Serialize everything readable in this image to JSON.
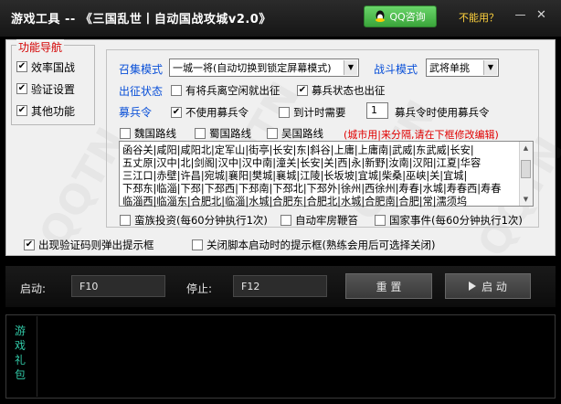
{
  "window": {
    "title": "游戏工具 -- 《三国乱世丨自动国战攻城v2.0》",
    "qq_button": "QQ咨询",
    "unavailable_link": "不能用？",
    "minimize": "—",
    "close": "✕"
  },
  "nav": {
    "title": "功能导航",
    "items": [
      {
        "label": "效率国战",
        "checked": true
      },
      {
        "label": "验证设置",
        "checked": true
      },
      {
        "label": "其他功能",
        "checked": true
      }
    ]
  },
  "settings": {
    "recruit_mode_label": "召集模式",
    "recruit_mode_value": "一城一将(自动切换到锁定屏幕模式)",
    "battle_mode_label": "战斗模式",
    "battle_mode_value": "武将单挑",
    "expedition_label": "出征状态",
    "opt_idle_troops": "有将兵离空闲就出征",
    "opt_recruit_state": "募兵状态也出征",
    "recruit_order_label": "募兵令",
    "opt_no_recruit_order": "不使用募兵令",
    "opt_timer_need": "到计时需要",
    "timer_value": "1",
    "opt_timer_suffix": "募兵令时使用募兵令",
    "routes": [
      {
        "label": "魏国路线",
        "checked": false
      },
      {
        "label": "蜀国路线",
        "checked": false
      },
      {
        "label": "吴国路线",
        "checked": false
      }
    ],
    "route_hint": "(城市用|来分隔,请在下框修改编辑)",
    "route_lines": [
      "函谷关|咸阳|咸阳北|定军山|街亭|长安|东|斜谷|上庸|上庸南|武威|东武威|长安|",
      "五丈原|汉中|北|剑阁|汉中|汉中南|潼关|长安|关|西|永|新野|汝南|汉阳|江夏|华容",
      "三江口|赤壁|许昌|宛城|襄阳|樊城|襄城|江陵|长坂坡|宜城|柴桑|巫峡|关|宜城|",
      "下邳东|临淄|下邳|下邳西|下邳南|下邳北|下邳外|徐州|西徐州|寿春|水城|寿春西|寿春",
      "临淄西|临淄东|合肥北|临淄|水城|合肥东|合肥北|水城|合肥南|合肥|常|濡须坞"
    ],
    "opt_barbarian": "蛮族投资(每60分钟执行1次)",
    "opt_auto_jail": "自动牢房鞭笞",
    "opt_state_event": "国家事件(每60分钟执行1次)",
    "opt_captcha_popup": "出现验证码则弹出提示框",
    "opt_close_tip": "关闭脚本启动时的提示框(熟练会用后可选择关闭)"
  },
  "controls": {
    "start_label": "启动:",
    "start_hotkey": "F10",
    "stop_label": "停止:",
    "stop_hotkey": "F12",
    "reset_button": "重 置",
    "start_button": "启 动"
  },
  "gift": {
    "label": "游戏礼包"
  },
  "watermark": "QQTN"
}
